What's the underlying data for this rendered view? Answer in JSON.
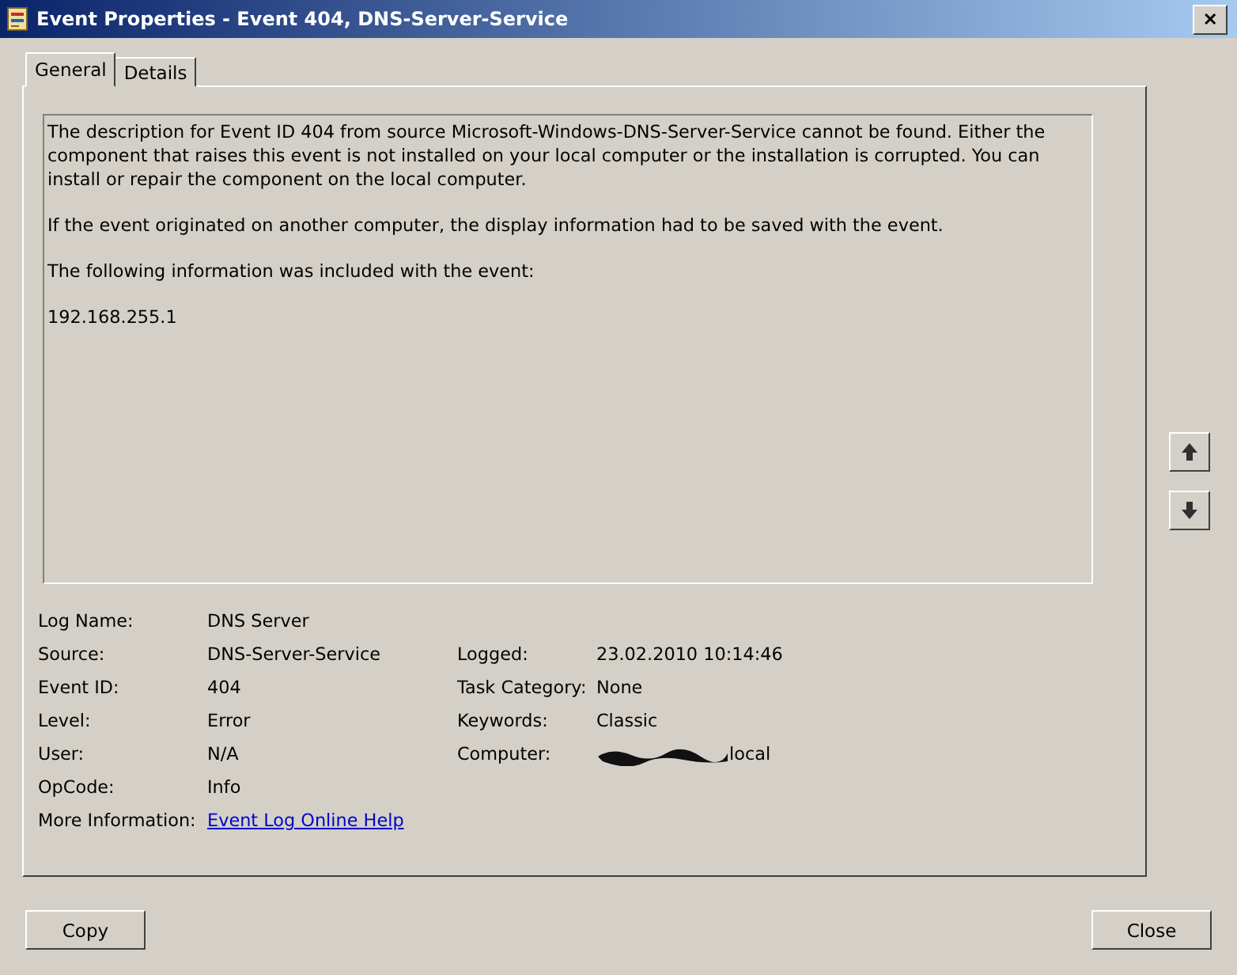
{
  "window": {
    "title": "Event Properties - Event 404, DNS-Server-Service",
    "close_glyph": "✕"
  },
  "tabs": [
    {
      "label": "General",
      "selected": true
    },
    {
      "label": "Details",
      "selected": false
    }
  ],
  "description": [
    "The description for Event ID 404 from source Microsoft-Windows-DNS-Server-Service cannot be found. Either the component that raises this event is not installed on your local computer or the installation is corrupted. You can install or repair the component on the local computer.",
    "If the event originated on another computer, the display information had to be saved with the event.",
    "The following information was included with the event:",
    "192.168.255.1"
  ],
  "fields_left": [
    {
      "label": "Log Name:",
      "value": "DNS Server"
    },
    {
      "label": "Source:",
      "value": "DNS-Server-Service"
    },
    {
      "label": "Event ID:",
      "value": "404"
    },
    {
      "label": "Level:",
      "value": "Error"
    },
    {
      "label": "User:",
      "value": "N/A"
    },
    {
      "label": "OpCode:",
      "value": "Info"
    },
    {
      "label": "More Information:",
      "value": "Event Log Online Help",
      "kind": "link"
    }
  ],
  "fields_right": [
    {
      "label": "Logged:",
      "value": "23.02.2010 10:14:46",
      "redacted": false
    },
    {
      "label": "Task Category:",
      "value": "None",
      "redacted": false
    },
    {
      "label": "Keywords:",
      "value": "Classic",
      "redacted": false
    },
    {
      "label": "Computer:",
      "value": "local",
      "redacted": true
    }
  ],
  "buttons": [
    {
      "label": "Copy"
    },
    {
      "label": "Close"
    }
  ]
}
